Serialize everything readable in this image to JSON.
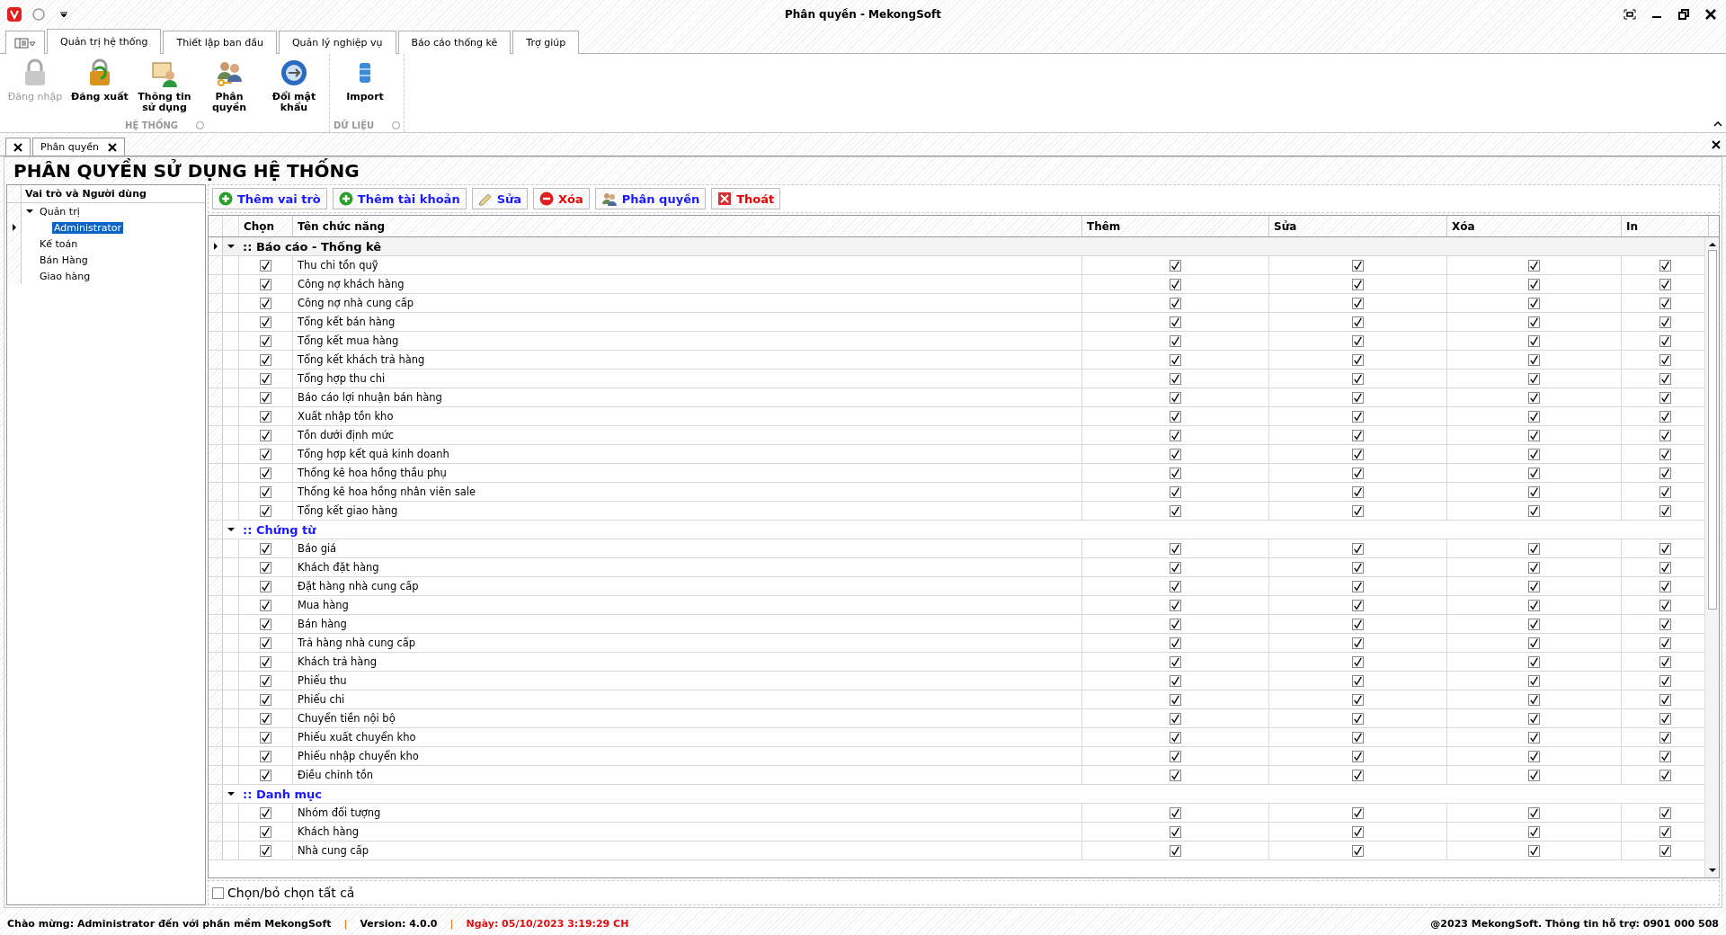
{
  "window": {
    "title": "Phân quyền - MekongSoft"
  },
  "ribbon": {
    "tabs": [
      {
        "label": "Quản trị hệ thống",
        "selected": true
      },
      {
        "label": "Thiết lập ban đầu",
        "selected": false
      },
      {
        "label": "Quản lý nghiệp vụ",
        "selected": false
      },
      {
        "label": "Báo cáo thống kê",
        "selected": false
      },
      {
        "label": "Trợ giúp",
        "selected": false
      }
    ],
    "groups": [
      {
        "label": "HỆ THỐNG",
        "buttons": [
          {
            "kind": "login",
            "label": "Đăng nhập",
            "disabled": true
          },
          {
            "kind": "logout",
            "label": "Đăng xuất",
            "disabled": false
          },
          {
            "kind": "info",
            "label": "Thông tin sử dụng",
            "disabled": false
          },
          {
            "kind": "perm",
            "label": "Phân quyền",
            "disabled": false
          },
          {
            "kind": "password",
            "label": "Đổi mật khẩu",
            "disabled": false
          }
        ]
      },
      {
        "label": "DỮ LIỆU",
        "buttons": [
          {
            "kind": "import",
            "label": "Import",
            "disabled": false
          }
        ]
      }
    ]
  },
  "document_tab": {
    "label": "Phân quyền"
  },
  "page_title": "PHÂN QUYỀN SỬ DỤNG HỆ THỐNG",
  "roles": {
    "heading": "Vai trò và Người dùng",
    "items": [
      {
        "label": "Quản trị",
        "expanded": true,
        "selected": false,
        "children": [
          {
            "label": "Administrator",
            "selected": true
          }
        ]
      },
      {
        "label": "Kế toán",
        "selected": false
      },
      {
        "label": "Bán Hàng",
        "selected": false
      },
      {
        "label": "Giao hàng",
        "selected": false
      }
    ]
  },
  "toolbar": [
    {
      "kind": "add",
      "label": "Thêm vai trò"
    },
    {
      "kind": "add",
      "label": "Thêm tài khoản"
    },
    {
      "kind": "edit",
      "label": "Sửa"
    },
    {
      "kind": "delete",
      "label": "Xóa"
    },
    {
      "kind": "perm",
      "label": "Phân quyền"
    },
    {
      "kind": "exit",
      "label": "Thoát"
    }
  ],
  "table": {
    "columns": [
      "Chọn",
      "Tên chức năng",
      "Thêm",
      "Sửa",
      "Xóa",
      "In"
    ],
    "groups": [
      {
        "label": ":: Báo cáo - Thống kê",
        "selected": true,
        "expanded": true,
        "rows": [
          {
            "name": "Thu chi tồn quỹ",
            "chon": true,
            "them": true,
            "sua": true,
            "xoa": true,
            "in": true
          },
          {
            "name": "Công nợ khách hàng",
            "chon": true,
            "them": true,
            "sua": true,
            "xoa": true,
            "in": true
          },
          {
            "name": "Công nợ nhà cung cấp",
            "chon": true,
            "them": true,
            "sua": true,
            "xoa": true,
            "in": true
          },
          {
            "name": "Tổng kết bán hàng",
            "chon": true,
            "them": true,
            "sua": true,
            "xoa": true,
            "in": true
          },
          {
            "name": "Tổng kết mua hàng",
            "chon": true,
            "them": true,
            "sua": true,
            "xoa": true,
            "in": true
          },
          {
            "name": "Tổng kết khách trả hàng",
            "chon": true,
            "them": true,
            "sua": true,
            "xoa": true,
            "in": true
          },
          {
            "name": "Tổng hợp thu chi",
            "chon": true,
            "them": true,
            "sua": true,
            "xoa": true,
            "in": true
          },
          {
            "name": "Báo cáo lợi nhuận bán hàng",
            "chon": true,
            "them": true,
            "sua": true,
            "xoa": true,
            "in": true
          },
          {
            "name": "Xuất nhập tồn kho",
            "chon": true,
            "them": true,
            "sua": true,
            "xoa": true,
            "in": true
          },
          {
            "name": "Tồn dưới định mức",
            "chon": true,
            "them": true,
            "sua": true,
            "xoa": true,
            "in": true
          },
          {
            "name": "Tổng hợp kết quả kinh doanh",
            "chon": true,
            "them": true,
            "sua": true,
            "xoa": true,
            "in": true
          },
          {
            "name": "Thống kê hoa hồng thầu phụ",
            "chon": true,
            "them": true,
            "sua": true,
            "xoa": true,
            "in": true
          },
          {
            "name": "Thống kê hoa hồng nhân viên sale",
            "chon": true,
            "them": true,
            "sua": true,
            "xoa": true,
            "in": true
          },
          {
            "name": "Tổng kết giao hàng",
            "chon": true,
            "them": true,
            "sua": true,
            "xoa": true,
            "in": true
          }
        ]
      },
      {
        "label": ":: Chứng từ",
        "selected": false,
        "expanded": true,
        "rows": [
          {
            "name": "Báo giá",
            "chon": true,
            "them": true,
            "sua": true,
            "xoa": true,
            "in": true
          },
          {
            "name": "Khách đặt hàng",
            "chon": true,
            "them": true,
            "sua": true,
            "xoa": true,
            "in": true
          },
          {
            "name": "Đặt hàng nhà cung cấp",
            "chon": true,
            "them": true,
            "sua": true,
            "xoa": true,
            "in": true
          },
          {
            "name": "Mua hàng",
            "chon": true,
            "them": true,
            "sua": true,
            "xoa": true,
            "in": true
          },
          {
            "name": "Bán hàng",
            "chon": true,
            "them": true,
            "sua": true,
            "xoa": true,
            "in": true
          },
          {
            "name": "Trả hàng nhà cung cấp",
            "chon": true,
            "them": true,
            "sua": true,
            "xoa": true,
            "in": true
          },
          {
            "name": "Khách trả hàng",
            "chon": true,
            "them": true,
            "sua": true,
            "xoa": true,
            "in": true
          },
          {
            "name": "Phiếu thu",
            "chon": true,
            "them": true,
            "sua": true,
            "xoa": true,
            "in": true
          },
          {
            "name": "Phiếu chi",
            "chon": true,
            "them": true,
            "sua": true,
            "xoa": true,
            "in": true
          },
          {
            "name": "Chuyển tiền nội bộ",
            "chon": true,
            "them": true,
            "sua": true,
            "xoa": true,
            "in": true
          },
          {
            "name": "Phiếu xuất chuyển kho",
            "chon": true,
            "them": true,
            "sua": true,
            "xoa": true,
            "in": true
          },
          {
            "name": "Phiếu nhập chuyển kho",
            "chon": true,
            "them": true,
            "sua": true,
            "xoa": true,
            "in": true
          },
          {
            "name": "Điều chỉnh tồn",
            "chon": true,
            "them": true,
            "sua": true,
            "xoa": true,
            "in": true
          }
        ]
      },
      {
        "label": ":: Danh mục",
        "selected": false,
        "expanded": true,
        "rows": [
          {
            "name": "Nhóm đối tượng",
            "chon": true,
            "them": true,
            "sua": true,
            "xoa": true,
            "in": true
          },
          {
            "name": "Khách hàng",
            "chon": true,
            "them": true,
            "sua": true,
            "xoa": true,
            "in": true
          },
          {
            "name": "Nhà cung cấp",
            "chon": true,
            "them": true,
            "sua": true,
            "xoa": true,
            "in": true
          }
        ]
      }
    ]
  },
  "select_all": {
    "label": "Chọn/bỏ chọn tất cả",
    "checked": false
  },
  "status_bar": {
    "welcome": "Chào mừng: Administrator đến với phần mềm MekongSoft",
    "separators": [
      "|",
      "|"
    ],
    "version": "Version: 4.0.0",
    "date": "Ngày: 05/10/2023 3:19:29 CH",
    "support": "@2023 MekongSoft. Thông tin hỗ trợ: 0901 000 508"
  }
}
